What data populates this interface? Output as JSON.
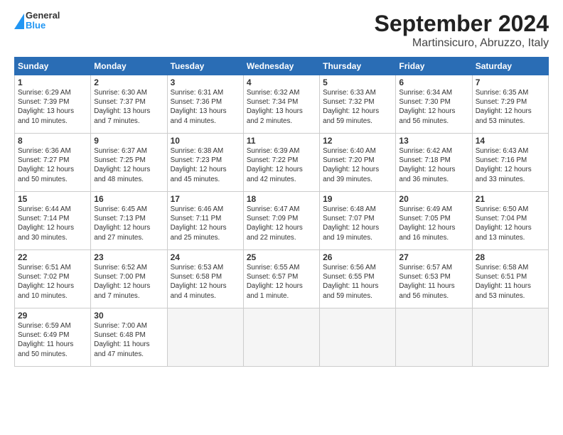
{
  "header": {
    "logo": {
      "line1": "General",
      "line2": "Blue"
    },
    "title": "September 2024",
    "subtitle": "Martinsicuro, Abruzzo, Italy"
  },
  "columns": [
    "Sunday",
    "Monday",
    "Tuesday",
    "Wednesday",
    "Thursday",
    "Friday",
    "Saturday"
  ],
  "weeks": [
    [
      {
        "day": 1,
        "info": "Sunrise: 6:29 AM\nSunset: 7:39 PM\nDaylight: 13 hours\nand 10 minutes."
      },
      {
        "day": 2,
        "info": "Sunrise: 6:30 AM\nSunset: 7:37 PM\nDaylight: 13 hours\nand 7 minutes."
      },
      {
        "day": 3,
        "info": "Sunrise: 6:31 AM\nSunset: 7:36 PM\nDaylight: 13 hours\nand 4 minutes."
      },
      {
        "day": 4,
        "info": "Sunrise: 6:32 AM\nSunset: 7:34 PM\nDaylight: 13 hours\nand 2 minutes."
      },
      {
        "day": 5,
        "info": "Sunrise: 6:33 AM\nSunset: 7:32 PM\nDaylight: 12 hours\nand 59 minutes."
      },
      {
        "day": 6,
        "info": "Sunrise: 6:34 AM\nSunset: 7:30 PM\nDaylight: 12 hours\nand 56 minutes."
      },
      {
        "day": 7,
        "info": "Sunrise: 6:35 AM\nSunset: 7:29 PM\nDaylight: 12 hours\nand 53 minutes."
      }
    ],
    [
      {
        "day": 8,
        "info": "Sunrise: 6:36 AM\nSunset: 7:27 PM\nDaylight: 12 hours\nand 50 minutes."
      },
      {
        "day": 9,
        "info": "Sunrise: 6:37 AM\nSunset: 7:25 PM\nDaylight: 12 hours\nand 48 minutes."
      },
      {
        "day": 10,
        "info": "Sunrise: 6:38 AM\nSunset: 7:23 PM\nDaylight: 12 hours\nand 45 minutes."
      },
      {
        "day": 11,
        "info": "Sunrise: 6:39 AM\nSunset: 7:22 PM\nDaylight: 12 hours\nand 42 minutes."
      },
      {
        "day": 12,
        "info": "Sunrise: 6:40 AM\nSunset: 7:20 PM\nDaylight: 12 hours\nand 39 minutes."
      },
      {
        "day": 13,
        "info": "Sunrise: 6:42 AM\nSunset: 7:18 PM\nDaylight: 12 hours\nand 36 minutes."
      },
      {
        "day": 14,
        "info": "Sunrise: 6:43 AM\nSunset: 7:16 PM\nDaylight: 12 hours\nand 33 minutes."
      }
    ],
    [
      {
        "day": 15,
        "info": "Sunrise: 6:44 AM\nSunset: 7:14 PM\nDaylight: 12 hours\nand 30 minutes."
      },
      {
        "day": 16,
        "info": "Sunrise: 6:45 AM\nSunset: 7:13 PM\nDaylight: 12 hours\nand 27 minutes."
      },
      {
        "day": 17,
        "info": "Sunrise: 6:46 AM\nSunset: 7:11 PM\nDaylight: 12 hours\nand 25 minutes."
      },
      {
        "day": 18,
        "info": "Sunrise: 6:47 AM\nSunset: 7:09 PM\nDaylight: 12 hours\nand 22 minutes."
      },
      {
        "day": 19,
        "info": "Sunrise: 6:48 AM\nSunset: 7:07 PM\nDaylight: 12 hours\nand 19 minutes."
      },
      {
        "day": 20,
        "info": "Sunrise: 6:49 AM\nSunset: 7:05 PM\nDaylight: 12 hours\nand 16 minutes."
      },
      {
        "day": 21,
        "info": "Sunrise: 6:50 AM\nSunset: 7:04 PM\nDaylight: 12 hours\nand 13 minutes."
      }
    ],
    [
      {
        "day": 22,
        "info": "Sunrise: 6:51 AM\nSunset: 7:02 PM\nDaylight: 12 hours\nand 10 minutes."
      },
      {
        "day": 23,
        "info": "Sunrise: 6:52 AM\nSunset: 7:00 PM\nDaylight: 12 hours\nand 7 minutes."
      },
      {
        "day": 24,
        "info": "Sunrise: 6:53 AM\nSunset: 6:58 PM\nDaylight: 12 hours\nand 4 minutes."
      },
      {
        "day": 25,
        "info": "Sunrise: 6:55 AM\nSunset: 6:57 PM\nDaylight: 12 hours\nand 1 minute."
      },
      {
        "day": 26,
        "info": "Sunrise: 6:56 AM\nSunset: 6:55 PM\nDaylight: 11 hours\nand 59 minutes."
      },
      {
        "day": 27,
        "info": "Sunrise: 6:57 AM\nSunset: 6:53 PM\nDaylight: 11 hours\nand 56 minutes."
      },
      {
        "day": 28,
        "info": "Sunrise: 6:58 AM\nSunset: 6:51 PM\nDaylight: 11 hours\nand 53 minutes."
      }
    ],
    [
      {
        "day": 29,
        "info": "Sunrise: 6:59 AM\nSunset: 6:49 PM\nDaylight: 11 hours\nand 50 minutes."
      },
      {
        "day": 30,
        "info": "Sunrise: 7:00 AM\nSunset: 6:48 PM\nDaylight: 11 hours\nand 47 minutes."
      },
      {
        "day": null,
        "info": ""
      },
      {
        "day": null,
        "info": ""
      },
      {
        "day": null,
        "info": ""
      },
      {
        "day": null,
        "info": ""
      },
      {
        "day": null,
        "info": ""
      }
    ]
  ]
}
